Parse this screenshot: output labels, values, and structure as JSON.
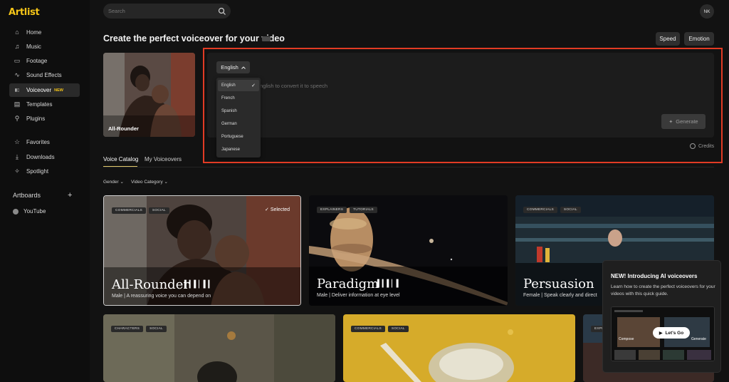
{
  "app": {
    "logo": "Artlist"
  },
  "sidebar": {
    "items": [
      {
        "label": "Home",
        "icon": "home-icon",
        "glyph": "⌂"
      },
      {
        "label": "Music",
        "icon": "music-icon",
        "glyph": "♫"
      },
      {
        "label": "Footage",
        "icon": "footage-icon",
        "glyph": "▭"
      },
      {
        "label": "Sound Effects",
        "icon": "sound-effects-icon",
        "glyph": "∿"
      },
      {
        "label": "Voiceover",
        "icon": "voiceover-icon",
        "glyph": "▮▯",
        "badge": "NEW",
        "active": true
      },
      {
        "label": "Templates",
        "icon": "templates-icon",
        "glyph": "▤"
      },
      {
        "label": "Plugins",
        "icon": "plugins-icon",
        "glyph": "⚲"
      },
      {
        "label": "Favorites",
        "icon": "favorites-icon",
        "glyph": "☆"
      },
      {
        "label": "Downloads",
        "icon": "downloads-icon",
        "glyph": "⤓"
      },
      {
        "label": "Spotlight",
        "icon": "spotlight-icon",
        "glyph": "✧"
      }
    ],
    "artboards_label": "Artboards",
    "artboards_items": [
      {
        "label": "YouTube"
      }
    ]
  },
  "header": {
    "search_placeholder": "Search",
    "avatar_initials": "NK"
  },
  "page": {
    "title": "Create the perfect voiceover for your video",
    "speed_label": "Speed",
    "emotion_label": "Emotion"
  },
  "hero_card": {
    "label": "All-Rounder"
  },
  "editor": {
    "language_selected": "English",
    "placeholder_visible": "nglish to convert it to speech",
    "generate_label": "Generate",
    "credits_label": "Credits",
    "language_options": [
      "English",
      "French",
      "Spanish",
      "German",
      "Portuguese",
      "Japanese"
    ]
  },
  "tabs": [
    "Voice Catalog",
    "My Voiceovers"
  ],
  "filters": [
    "Gender",
    "Video Category"
  ],
  "voices": [
    {
      "title": "All-Rounder",
      "tags": [
        "COMMERCIALS",
        "SOCIAL"
      ],
      "desc": "Male | A reassuring voice you can depend on",
      "selected_label": "Selected"
    },
    {
      "title": "Paradigm",
      "tags": [
        "EXPLAINERS",
        "TUTORIALS"
      ],
      "desc": "Male | Deliver information at eye level"
    },
    {
      "title": "Persuasion",
      "tags": [
        "COMMERCIALS",
        "SOCIAL"
      ],
      "desc": "Female | Speak clearly and direct"
    },
    {
      "title": "",
      "tags": [
        "CHARACTERS",
        "SOCIAL"
      ],
      "desc": ""
    },
    {
      "title": "",
      "tags": [
        "COMMERCIALS",
        "SOCIAL"
      ],
      "desc": ""
    },
    {
      "title": "",
      "tags": [
        "EXPL"
      ],
      "desc": ""
    }
  ],
  "popup": {
    "title": "NEW! Introducing AI voiceovers",
    "body": "Learn how to create the perfect voiceovers for your videos with this quick guide.",
    "cta": "Let's Go",
    "preview_text_1": "Compose",
    "preview_text_2": "Generate"
  },
  "colors": {
    "accent": "#f5c518",
    "highlight_outline": "#e23b24",
    "background": "#121212"
  }
}
